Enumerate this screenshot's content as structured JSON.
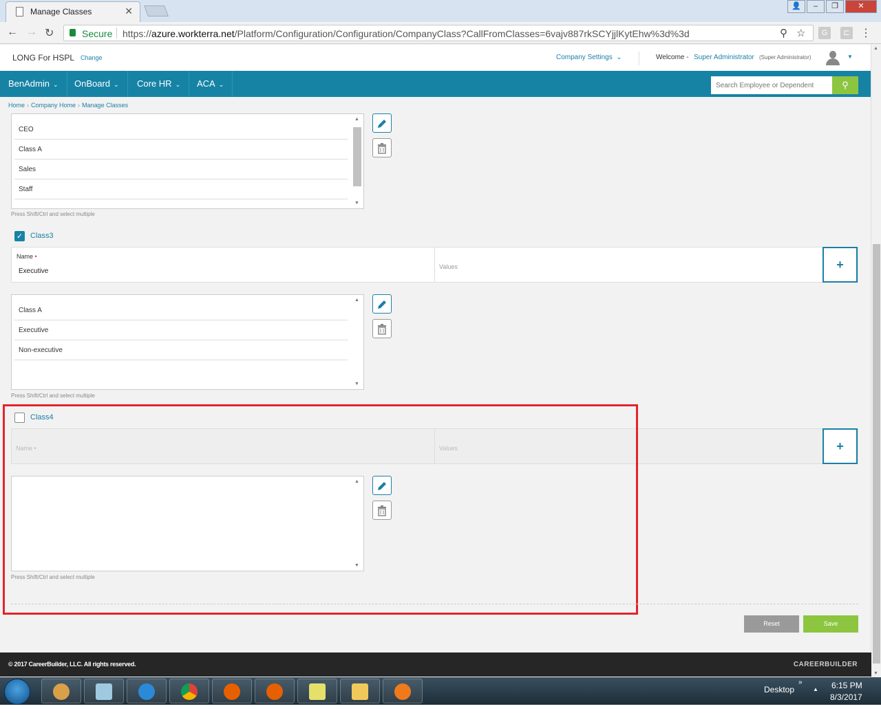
{
  "browser": {
    "tab_title": "Manage Classes",
    "secure_label": "Secure",
    "url_scheme": "https://",
    "url_host": "azure.workterra.net",
    "url_path": "/Platform/Configuration/Configuration/CompanyClass?CallFromClasses=6vajv887rkSCYjjlKytEhw%3d%3d"
  },
  "header": {
    "company": "LONG For HSPL",
    "change_label": "Change",
    "company_settings": "Company Settings",
    "welcome": "Welcome -",
    "user": "Super Administrator",
    "user_role": "(Super Administrator)"
  },
  "nav": {
    "items": [
      {
        "label": "BenAdmin"
      },
      {
        "label": "OnBoard"
      },
      {
        "label": "Core HR"
      },
      {
        "label": "ACA"
      }
    ],
    "search_placeholder": "Search Employee or Dependent"
  },
  "breadcrumb": [
    "Home",
    "Company Home",
    "Manage Classes"
  ],
  "list1": {
    "items": [
      "CEO",
      "Class A",
      "Sales",
      "Staff"
    ],
    "hint": "Press Shift/Ctrl and select multiple"
  },
  "class3": {
    "label": "Class3",
    "checked": true,
    "name_label": "Name",
    "name_value": "Executive",
    "values_placeholder": "Values",
    "list_items": [
      "Class A",
      "Executive",
      "Non-executive"
    ],
    "hint": "Press Shift/Ctrl and select multiple"
  },
  "class4": {
    "label": "Class4",
    "checked": false,
    "name_label": "Name",
    "values_placeholder": "Values",
    "hint": "Press Shift/Ctrl and select multiple"
  },
  "actions": {
    "reset": "Reset",
    "save": "Save"
  },
  "footer": {
    "copyright": "© 2017 CareerBuilder, LLC. All rights reserved.",
    "logo": "CAREERBUILDER"
  },
  "taskbar": {
    "desktop": "Desktop",
    "time": "6:15 PM",
    "date": "8/3/2017"
  },
  "colors": {
    "brand": "#1683a5",
    "save": "#8cc540",
    "highlight": "#e3232b"
  }
}
